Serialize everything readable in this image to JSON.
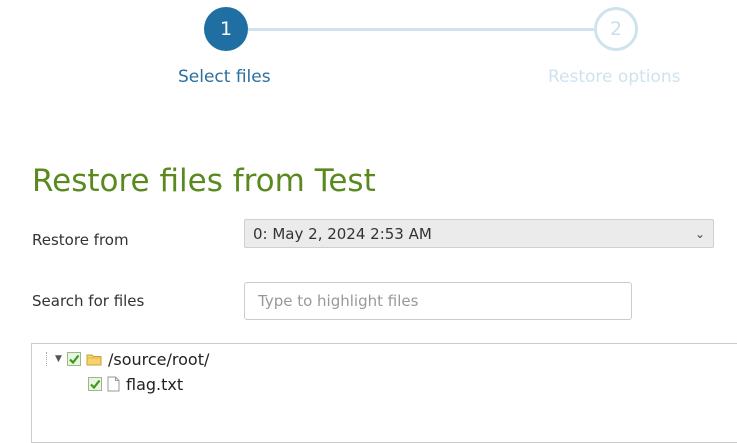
{
  "stepper": {
    "steps": [
      {
        "number": "1",
        "label": "Select files",
        "state": "active"
      },
      {
        "number": "2",
        "label": "Restore options",
        "state": "pending"
      }
    ]
  },
  "page": {
    "title": "Restore files from Test"
  },
  "form": {
    "restore_from": {
      "label": "Restore from",
      "selected": "0: May 2, 2024 2:53 AM"
    },
    "search": {
      "label": "Search for files",
      "placeholder": "Type to highlight files",
      "value": ""
    }
  },
  "tree": {
    "root": {
      "name": "/source/root/",
      "checked": true,
      "expanded": true,
      "icon": "folder-icon"
    },
    "children": [
      {
        "name": "flag.txt",
        "checked": true,
        "icon": "file-icon"
      }
    ]
  },
  "colors": {
    "accent": "#1f6fa3",
    "title_green": "#5a8a1f",
    "step_pending": "#cfe3ef",
    "check_green": "#3a9a1a"
  }
}
